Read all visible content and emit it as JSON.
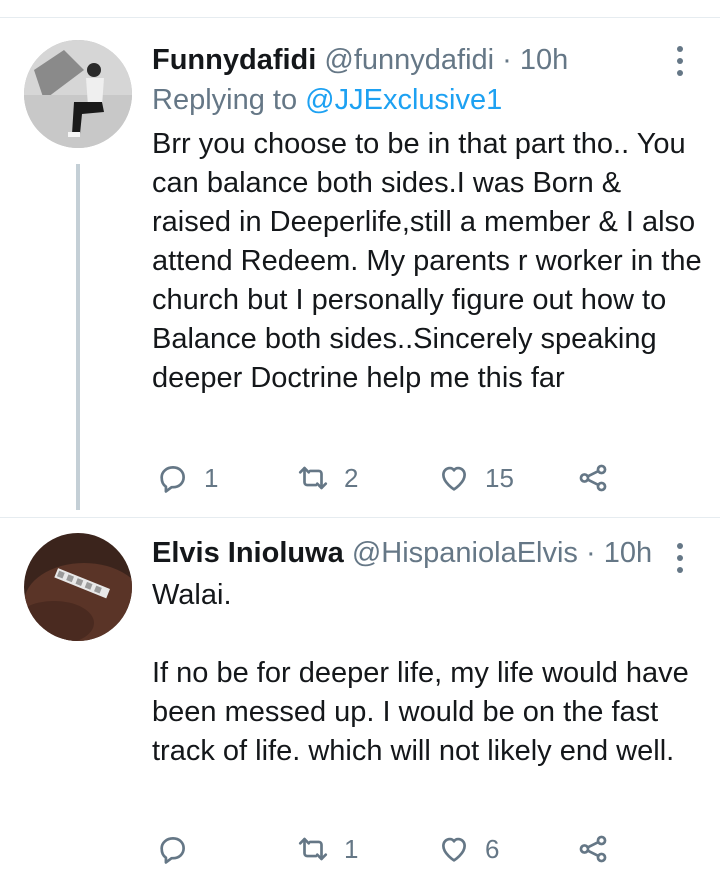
{
  "tweets": [
    {
      "name": "Funnydafidi",
      "handle": "@funnydafidi",
      "separator": "·",
      "time": "10h",
      "replying_prefix": "Replying to",
      "replying_to": "@JJExclusive1",
      "body": "Brr you choose to be in that part tho.. You can balance both sides.I was Born & raised in Deeperlife,still a member & I also attend Redeem. My parents r worker in the church but I personally figure out how to Balance both sides..Sincerely speaking deeper Doctrine help me this far",
      "reply_count": "1",
      "retweet_count": "2",
      "like_count": "15"
    },
    {
      "name": "Elvis Inioluwa",
      "handle": "@HispaniolaElvis",
      "separator": "·",
      "time": "10h",
      "body_line1": "Walai.",
      "body_para2": "If no be for deeper life, my life would have been messed up. I would be on the fast track of life. which will not likely end well.",
      "reply_count": "",
      "retweet_count": "1",
      "like_count": "6"
    }
  ],
  "icons": {
    "reply": "reply-icon",
    "retweet": "retweet-icon",
    "like": "heart-icon",
    "share": "share-icon",
    "more": "more-vertical-icon"
  },
  "colors": {
    "text": "#14171a",
    "secondary": "#657786",
    "link": "#1da1f2",
    "thread_line": "#c4cfd6"
  }
}
